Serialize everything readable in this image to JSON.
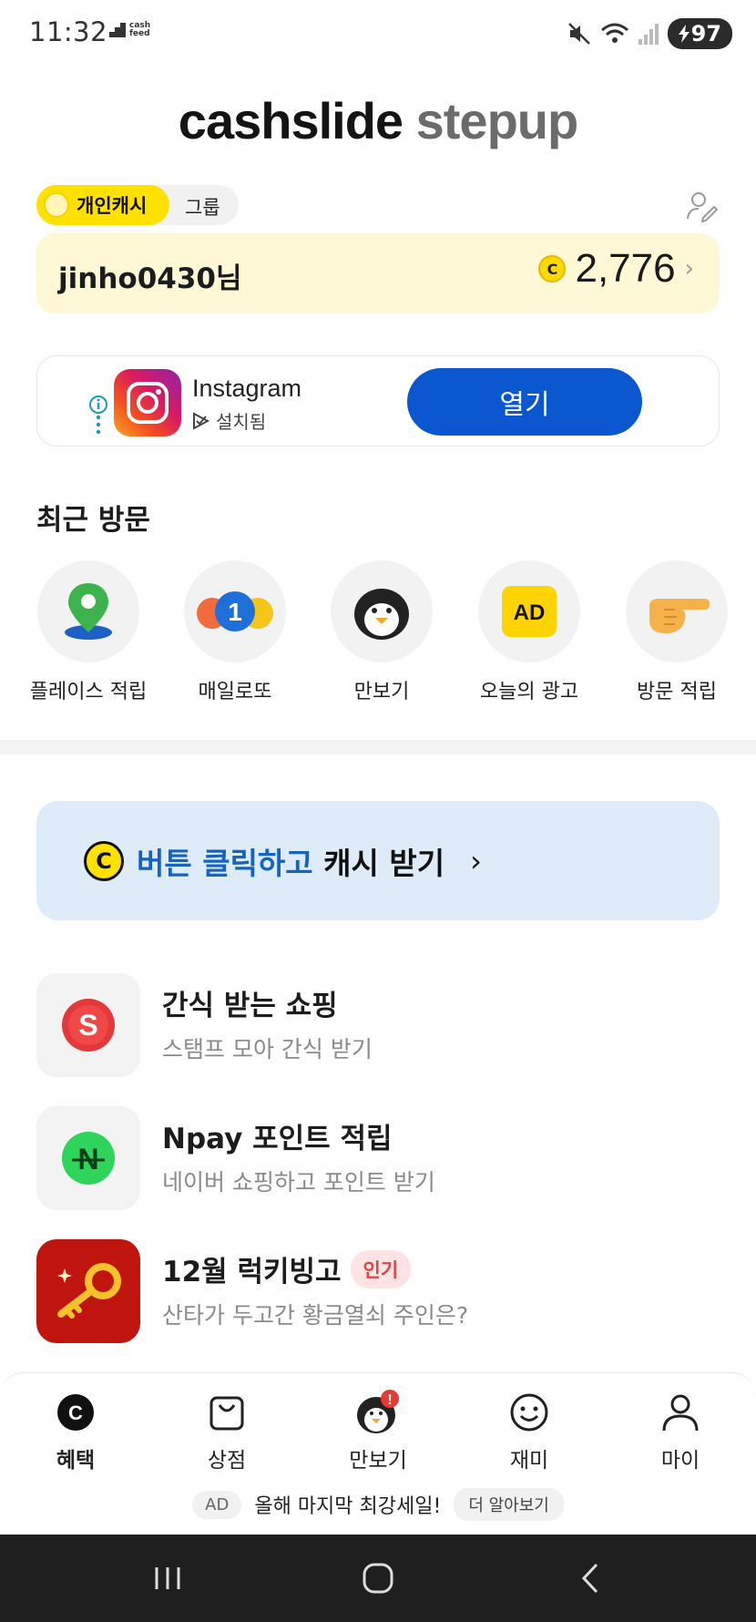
{
  "status_bar": {
    "time": "11:32",
    "cashfeed_line1": "cash",
    "cashfeed_line2": "feed",
    "battery": "97"
  },
  "header": {
    "title_part1": "cashslide",
    "title_part2": "stepup"
  },
  "mode_toggle": {
    "active_label": "개인캐시",
    "inactive_label": "그룹"
  },
  "balance": {
    "user_name": "jinho0430님",
    "coin_symbol": "C",
    "amount": "2,776"
  },
  "ad": {
    "app_name": "Instagram",
    "install_status": "설치됨",
    "open_label": "열기"
  },
  "recent": {
    "title": "최근 방문",
    "items": [
      {
        "label": "플레이스 적립",
        "icon": "map-pin-icon"
      },
      {
        "label": "매일로또",
        "icon": "lotto-balls-icon"
      },
      {
        "label": "만보기",
        "icon": "penguin-icon"
      },
      {
        "label": "오늘의 광고",
        "icon": "ad-icon"
      },
      {
        "label": "방문 적립",
        "icon": "pointing-hand-icon"
      }
    ],
    "ad_icon_text": "AD",
    "lotto_number": "1"
  },
  "banner": {
    "coin_symbol": "C",
    "text_blue": "버튼 클릭하고",
    "text_dark": " 캐시 받기"
  },
  "features": [
    {
      "title": "간식 받는 쇼핑",
      "subtitle": "스탬프 모아 간식 받기",
      "icon": "shopping-s-icon",
      "icon_text": "S"
    },
    {
      "title": "Npay 포인트 적립",
      "subtitle": "네이버 쇼핑하고 포인트 받기",
      "icon": "npay-icon",
      "icon_text": "N"
    },
    {
      "title": "12월 럭키빙고",
      "subtitle": "산타가 두고간 황금열쇠 주인은?",
      "icon": "golden-key-icon",
      "badge": "인기"
    }
  ],
  "bottom_nav": {
    "items": [
      {
        "label": "혜택",
        "icon": "coin-c-icon",
        "active": true
      },
      {
        "label": "상점",
        "icon": "shopping-bag-icon",
        "active": false
      },
      {
        "label": "만보기",
        "icon": "penguin-icon",
        "active": false
      },
      {
        "label": "재미",
        "icon": "smile-icon",
        "active": false
      },
      {
        "label": "마이",
        "icon": "person-icon",
        "active": false
      }
    ],
    "nav_coin_symbol": "C",
    "alert_mark": "!",
    "ad_tag": "AD",
    "ad_headline": "올해 마지막 최강세일!",
    "more_label": "더 알아보기"
  },
  "colors": {
    "accent_yellow": "#ffe100",
    "balance_bg": "#fff8d6",
    "open_button": "#0b57d0",
    "banner_bg": "#deecfa",
    "banner_blue": "#1565c0",
    "hot_badge": "#e04545"
  }
}
